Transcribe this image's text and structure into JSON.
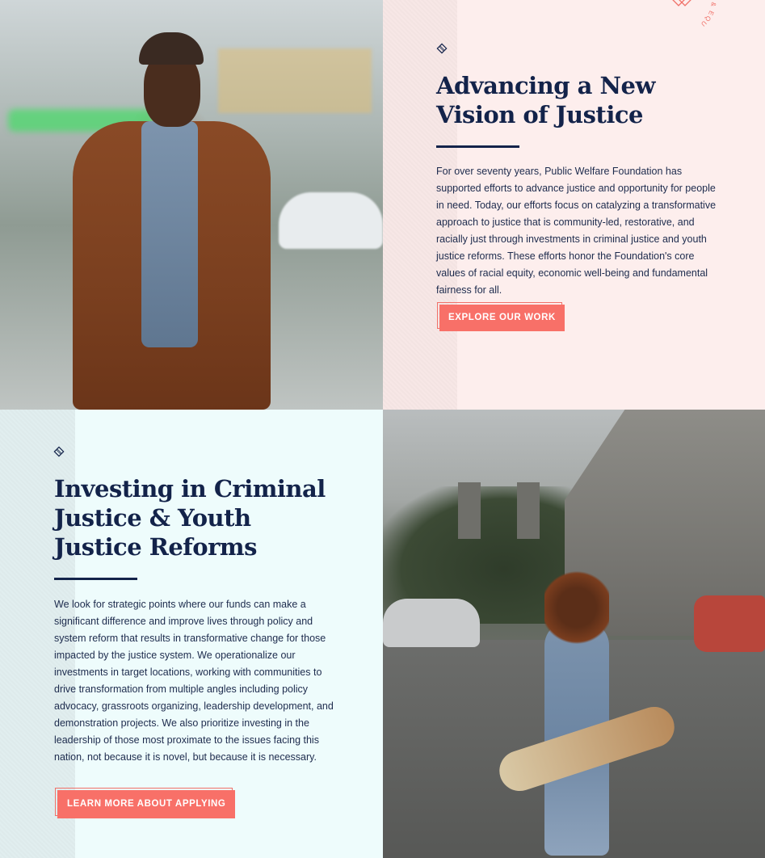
{
  "section1": {
    "heading_line1": "Advancing a New",
    "heading_line2": "Vision of Justice",
    "body": "For over seventy years, Public Welfare Foundation has supported efforts to advance justice and opportunity for people in need. Today, our efforts focus on catalyzing a transformative approach to justice that is community-led, restorative, and racially just through investments in criminal justice and youth justice reforms. These efforts honor the Foundation's core values of racial equity, economic well-being and fundamental fairness for all.",
    "button_label": "EXPLORE OUR WORK"
  },
  "section2": {
    "heading_line1": "Investing in Criminal",
    "heading_line2": "Justice & Youth",
    "heading_line3": "Justice Reforms",
    "body": "We look for strategic points where our funds can make a significant difference and improve lives through policy and system reform that results in transformative change for those impacted by the justice system. We operationalize our investments in target locations, working with communities to drive transformation from multiple angles including policy advocacy, grassroots organizing, leadership development, and demonstration projects. We also prioritize investing in the leadership of those most proximate to the issues facing this nation, not because it is novel, but because it is necessary.",
    "button_label": "LEARN MORE ABOUT APPLYING"
  },
  "seal": {
    "text": "TICE, OPPORTUNITY & EQU"
  },
  "colors": {
    "navy": "#13234a",
    "coral": "#f87068",
    "pink_bg": "#fdeeed",
    "mint_bg": "#eefcfc"
  },
  "icons": {
    "section_marker": "diamond-icon"
  }
}
